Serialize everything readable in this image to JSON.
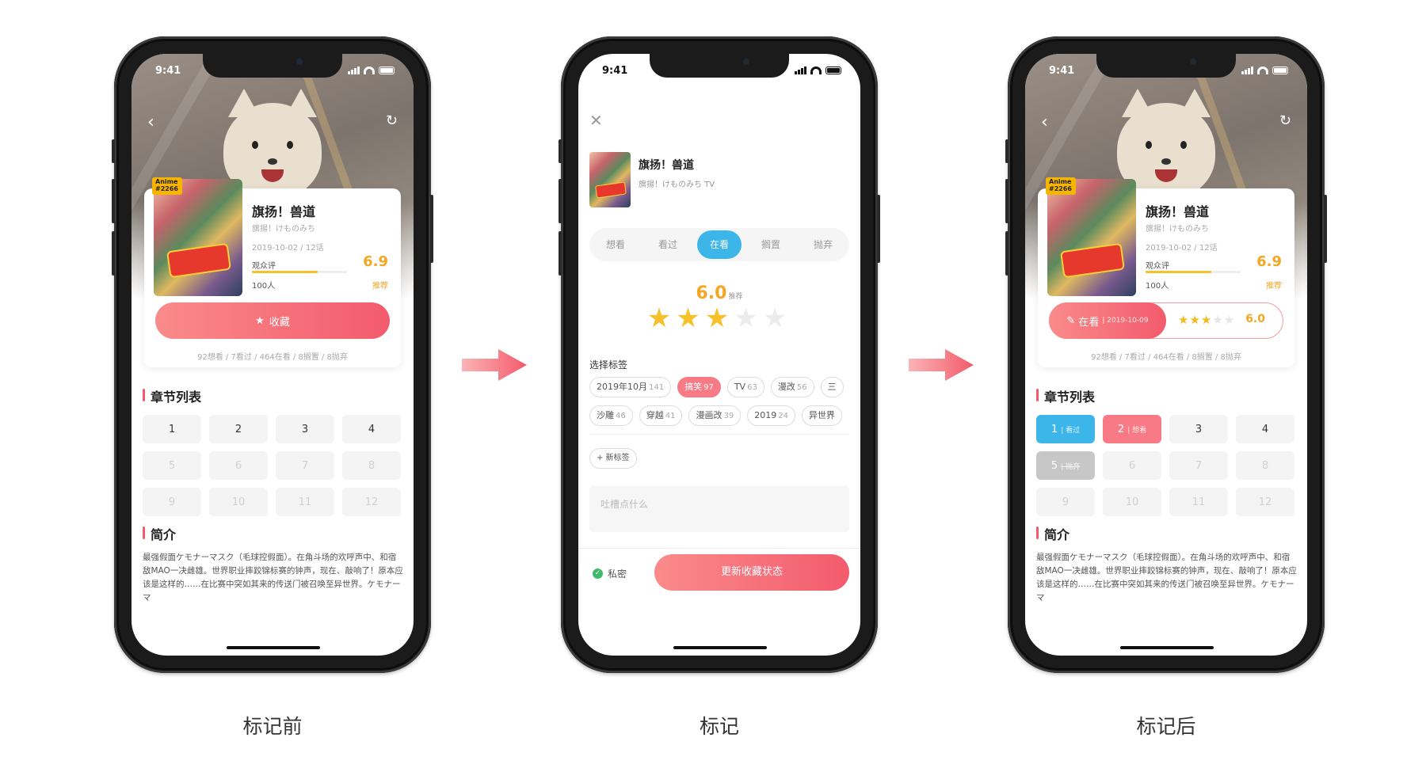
{
  "status_time": "9:41",
  "anime": {
    "badge_line1": "Anime",
    "badge_line2": "#2266",
    "title": "旗扬！兽道",
    "subtitle": "旗揚！けものみち",
    "subtitle_tv": "旗揚！けものみち TV",
    "date_episodes": "2019-10-02 / 12话",
    "audience_label": "观众评",
    "audience_score": "6.9",
    "audience_fill": 0.69,
    "people": "100人",
    "recommend": "推荐",
    "stats": "92想看 / 7看过 / 464在看 / 8搁置 / 8抛弃"
  },
  "before": {
    "collect_label": "收藏",
    "chapters_title": "章节列表",
    "chapters": [
      {
        "n": "1",
        "tag": "",
        "state": "normal"
      },
      {
        "n": "2",
        "tag": "",
        "state": "normal"
      },
      {
        "n": "3",
        "tag": "",
        "state": "normal"
      },
      {
        "n": "4",
        "tag": "",
        "state": "normal"
      },
      {
        "n": "5",
        "tag": "",
        "state": "dim"
      },
      {
        "n": "6",
        "tag": "",
        "state": "dim"
      },
      {
        "n": "7",
        "tag": "",
        "state": "dim"
      },
      {
        "n": "8",
        "tag": "",
        "state": "dim"
      },
      {
        "n": "9",
        "tag": "",
        "state": "dim"
      },
      {
        "n": "10",
        "tag": "",
        "state": "dim"
      },
      {
        "n": "11",
        "tag": "",
        "state": "dim"
      },
      {
        "n": "12",
        "tag": "",
        "state": "dim"
      }
    ]
  },
  "after": {
    "status_label": "在看",
    "status_date": "2019-10-09",
    "stars": 3,
    "score": "6.0",
    "chapters_title": "章节列表",
    "chapters": [
      {
        "n": "1",
        "tag": "看过",
        "state": "blue"
      },
      {
        "n": "2",
        "tag": "想看",
        "state": "pink"
      },
      {
        "n": "3",
        "tag": "",
        "state": "normal"
      },
      {
        "n": "4",
        "tag": "",
        "state": "normal"
      },
      {
        "n": "5",
        "tag": "抛弃",
        "state": "gray"
      },
      {
        "n": "6",
        "tag": "",
        "state": "dim"
      },
      {
        "n": "7",
        "tag": "",
        "state": "dim"
      },
      {
        "n": "8",
        "tag": "",
        "state": "dim"
      },
      {
        "n": "9",
        "tag": "",
        "state": "dim"
      },
      {
        "n": "10",
        "tag": "",
        "state": "dim"
      },
      {
        "n": "11",
        "tag": "",
        "state": "dim"
      },
      {
        "n": "12",
        "tag": "",
        "state": "dim"
      }
    ]
  },
  "intro": {
    "title": "简介",
    "text": "最强假面ケモナーマスク（毛球控假面）。在角斗场的欢呼声中、和宿敌MAO一决雌雄。世界职业摔跤锦标赛的钟声，现在、敲响了！原本应该是这样的……在比赛中突如其来的传送门被召唤至异世界。ケモナーマ"
  },
  "mark": {
    "segments": [
      "想看",
      "看过",
      "在看",
      "搁置",
      "抛弃"
    ],
    "active_segment": 2,
    "score": "6.0",
    "score_hint": "推荐",
    "stars": 3,
    "tags_label": "选择标签",
    "tags_row1": [
      {
        "name": "2019年10月",
        "count": "141",
        "on": false
      },
      {
        "name": "搞笑",
        "count": "97",
        "on": true
      },
      {
        "name": "TV",
        "count": "63",
        "on": false
      },
      {
        "name": "漫改",
        "count": "56",
        "on": false
      },
      {
        "name": "三",
        "count": "",
        "on": false
      }
    ],
    "tags_row2": [
      {
        "name": "沙雕",
        "count": "46",
        "on": false
      },
      {
        "name": "穿越",
        "count": "41",
        "on": false
      },
      {
        "name": "漫画改",
        "count": "39",
        "on": false
      },
      {
        "name": "2019",
        "count": "24",
        "on": false
      },
      {
        "name": "异世界",
        "count": "",
        "on": false
      }
    ],
    "new_tag": "+ 新标签",
    "comment_placeholder": "吐槽点什么",
    "private_label": "私密",
    "update_label": "更新收藏状态"
  },
  "captions": {
    "before": "标记前",
    "mark": "标记",
    "after": "标记后"
  },
  "colors": {
    "accent_pink": "#f35b6d",
    "accent_blue": "#3cb5e8",
    "score_orange": "#f5a623"
  }
}
